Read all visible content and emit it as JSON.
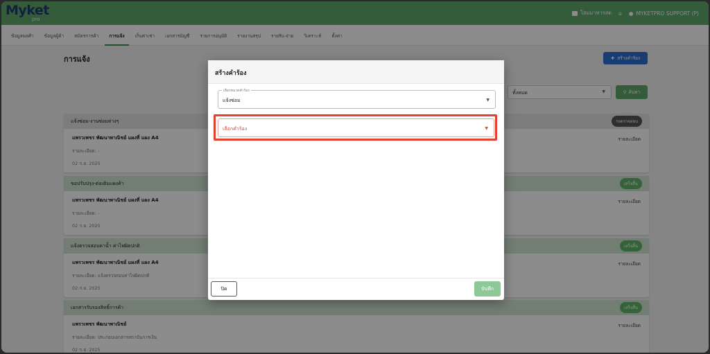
{
  "header": {
    "logo": "Myket",
    "logo_sub": "pro",
    "shop_link": "โฮมมาหารสด",
    "user": "MYKETPRO SUPPORT (P)",
    "accent": "#5fa86a"
  },
  "nav": {
    "items": [
      "ข้อมูลพลศ้า",
      "ข้อมูลผู้ค้า",
      "สมัครการค้า",
      "การแจ้ง",
      "เก็บค่าเช่า",
      "เอกสารบัญชี",
      "รายการอนุมัติ",
      "รายงานสรุป",
      "รายรับ-จ่าย",
      "วิเคราะห์",
      "ตั้งค่า"
    ],
    "active_index": 3
  },
  "page": {
    "title": "การแจ้ง",
    "create_button": "สร้างคำร้อง",
    "filter_value": "ทั้งหมด",
    "search_button": "ค้นหา",
    "detail_label": "รายละเอียด"
  },
  "cards": [
    {
      "title": "แจ้งซ่อม-งานซ่อมต่างๆ",
      "badge": "รอตรวจสอบ",
      "name": "แพรวเพชร พัฒนาพาณิชย์ แผงที่ แผง A4",
      "detail": "รายละเอียด: -",
      "date": "02 ก.ย. 2025"
    },
    {
      "title": "ขอปรับปรุง-ต่อเติมแผงค้า",
      "badge": "เสร็จสิ้น",
      "name": "แพรวเพชร พัฒนาพาณิชย์ แผงที่ แผง A4",
      "detail": "รายละเอียด: -",
      "date": "02 ก.ย. 2025"
    },
    {
      "title": "แจ้งตรวจสอบค่าน้ำ ค่าไฟผิดปกติ",
      "badge": "เสร็จสิ้น",
      "name": "แพรวเพชร พัฒนาพาณิชย์ แผงที่ แผง A4",
      "detail": "รายละเอียด: แจ้งตรวจสอบค่าไฟผิดปกติ",
      "date": "02 ก.ย. 2025"
    },
    {
      "title": "เอกสารรับรองสิทธิ์การค้า",
      "badge": "เสร็จสิ้น",
      "name": "แพรวเพชร พัฒนาพาณิชย์",
      "detail": "รายละเอียด: ประกอบเอกสารสถาบันการเงิน",
      "date": "02 ก.ย. 2025"
    }
  ],
  "modal": {
    "title": "สร้างคำร้อง",
    "category_label": "เลือกหมวดคำร้อง",
    "category_value": "แจ้งซ่อม",
    "request_placeholder": "เลือกคำร้อง",
    "close_button": "ปิด",
    "save_button": "บันทึก"
  }
}
